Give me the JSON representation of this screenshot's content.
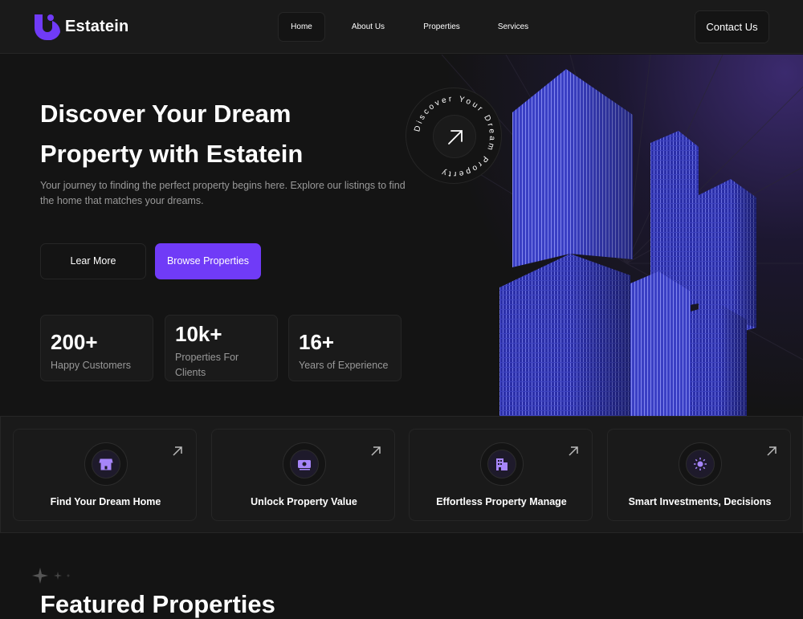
{
  "brand": {
    "name": "Estatein",
    "accent": "#703bf7"
  },
  "nav": {
    "items": [
      {
        "label": "Home",
        "active": true
      },
      {
        "label": "About Us"
      },
      {
        "label": "Properties"
      },
      {
        "label": "Services"
      }
    ],
    "contact_label": "Contact Us"
  },
  "hero": {
    "title_line1": "Discover Your Dream",
    "title_line2": "Property with Estatein",
    "subtitle": "Your journey to finding the perfect property begins here. Explore our listings to find the home that matches your dreams.",
    "learn_more_label": "Lear More",
    "browse_label": "Browse Properties",
    "badge_text": "Discover Your Dream Property",
    "stats": [
      {
        "value": "200+",
        "label": "Happy Customers"
      },
      {
        "value": "10k+",
        "label": "Properties For Clients"
      },
      {
        "value": "16+",
        "label": "Years of Experience"
      }
    ]
  },
  "features": [
    {
      "label": "Find Your Dream Home",
      "icon": "home-icon"
    },
    {
      "label": "Unlock Property Value",
      "icon": "money-icon"
    },
    {
      "label": "Effortless Property Manage",
      "icon": "building-icon"
    },
    {
      "label": "Smart Investments, Decisions",
      "icon": "sun-icon"
    }
  ],
  "featured": {
    "title": "Featured Properties"
  }
}
